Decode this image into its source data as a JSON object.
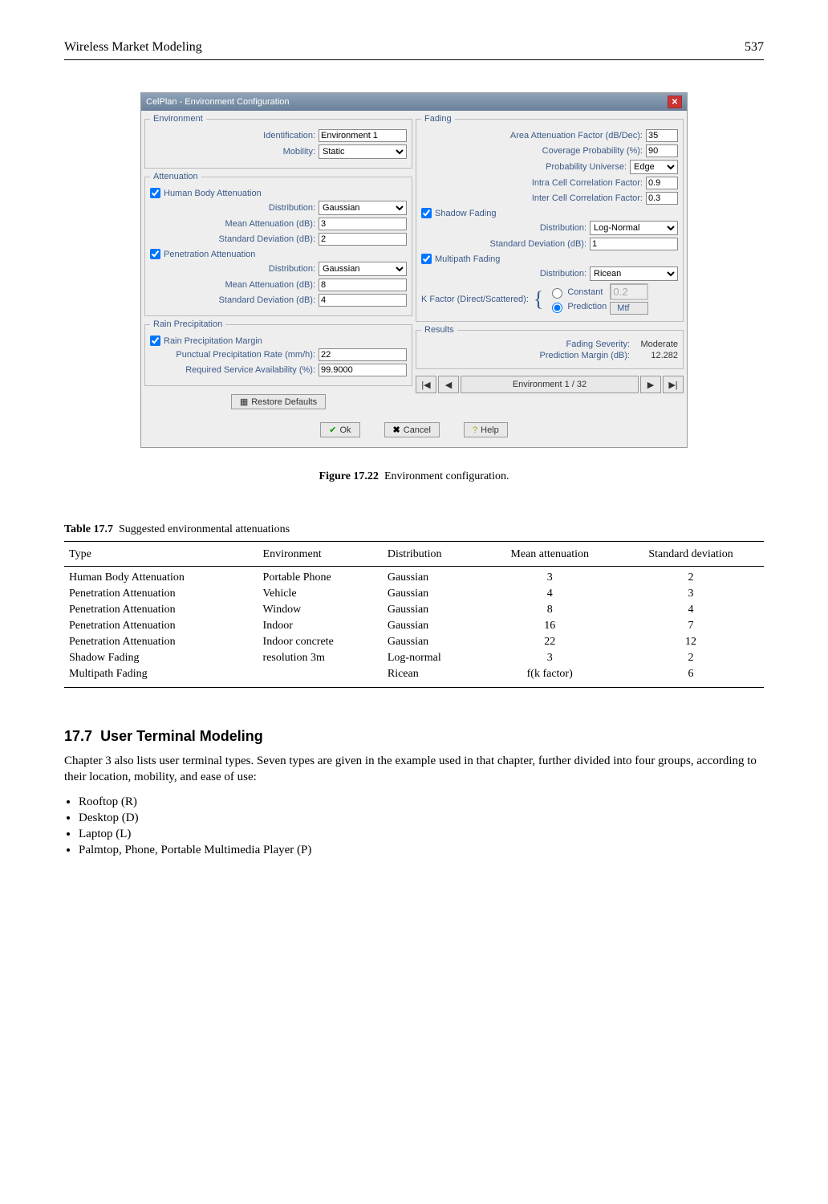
{
  "header": {
    "left": "Wireless Market Modeling",
    "right": "537"
  },
  "dialog": {
    "title": "CelPlan - Environment Configuration",
    "environment": {
      "legend": "Environment",
      "identification_label": "Identification:",
      "identification_value": "Environment 1",
      "mobility_label": "Mobility:",
      "mobility_value": "Static"
    },
    "attenuation": {
      "legend": "Attenuation",
      "human_body_label": "Human Body Attenuation",
      "distribution_label": "Distribution:",
      "distribution_value": "Gaussian",
      "mean_label": "Mean Attenuation (dB):",
      "mean_value": "3",
      "std_label": "Standard Deviation (dB):",
      "std_value": "2",
      "penetration_label": "Penetration Attenuation",
      "pen_distribution_value": "Gaussian",
      "pen_mean_value": "8",
      "pen_std_value": "4"
    },
    "rain": {
      "legend": "Rain Precipitation",
      "margin_label": "Rain Precipitation Margin",
      "rate_label": "Punctual Precipitation Rate (mm/h):",
      "rate_value": "22",
      "avail_label": "Required Service Availability (%):",
      "avail_value": "99.9000"
    },
    "restore_label": "Restore Defaults",
    "fading": {
      "legend": "Fading",
      "area_att_label": "Area Attenuation Factor (dB/Dec):",
      "area_att_value": "35",
      "cov_prob_label": "Coverage Probability (%):",
      "cov_prob_value": "90",
      "prob_univ_label": "Probability Universe:",
      "prob_univ_value": "Edge",
      "intra_label": "Intra Cell Correlation Factor:",
      "intra_value": "0.9",
      "inter_label": "Inter Cell Correlation Factor:",
      "inter_value": "0.3",
      "shadow_label": "Shadow Fading",
      "shadow_dist_label": "Distribution:",
      "shadow_dist_value": "Log-Normal",
      "shadow_std_label": "Standard Deviation (dB):",
      "shadow_std_value": "1",
      "multipath_label": "Multipath Fading",
      "multipath_dist_value": "Ricean",
      "kfactor_label": "K Factor (Direct/Scattered):",
      "kf_constant_label": "Constant",
      "kf_constant_value": "0.2",
      "kf_prediction_label": "Prediction",
      "kf_mtf_label": "Mtf"
    },
    "results": {
      "legend": "Results",
      "severity_label": "Fading Severity:",
      "severity_value": "Moderate",
      "margin_label": "Prediction Margin (dB):",
      "margin_value": "12.282"
    },
    "nav": {
      "counter": "Environment 1 / 32"
    },
    "buttons": {
      "ok": "Ok",
      "cancel": "Cancel",
      "help": "Help"
    }
  },
  "figure_caption": {
    "bold": "Figure 17.22",
    "text": "Environment configuration."
  },
  "table_caption": {
    "bold": "Table 17.7",
    "text": "Suggested environmental attenuations"
  },
  "table": {
    "headers": [
      "Type",
      "Environment",
      "Distribution",
      "Mean attenuation",
      "Standard deviation"
    ],
    "rows": [
      [
        "Human Body Attenuation",
        "Portable Phone",
        "Gaussian",
        "3",
        "2"
      ],
      [
        "Penetration Attenuation",
        "Vehicle",
        "Gaussian",
        "4",
        "3"
      ],
      [
        "Penetration Attenuation",
        "Window",
        "Gaussian",
        "8",
        "4"
      ],
      [
        "Penetration Attenuation",
        "Indoor",
        "Gaussian",
        "16",
        "7"
      ],
      [
        "Penetration Attenuation",
        "Indoor concrete",
        "Gaussian",
        "22",
        "12"
      ],
      [
        "Shadow Fading",
        "resolution 3m",
        "Log-normal",
        "3",
        "2"
      ],
      [
        "Multipath Fading",
        "",
        "Ricean",
        "f(k factor)",
        "6"
      ]
    ]
  },
  "section": {
    "number": "17.7",
    "title": "User Terminal Modeling",
    "paragraph": "Chapter 3 also lists user terminal types. Seven types are given in the example used in that chapter, further divided into four groups, according to their location, mobility, and ease of use:",
    "bullets": [
      "Rooftop (R)",
      "Desktop (D)",
      "Laptop (L)",
      "Palmtop, Phone, Portable Multimedia Player (P)"
    ]
  }
}
